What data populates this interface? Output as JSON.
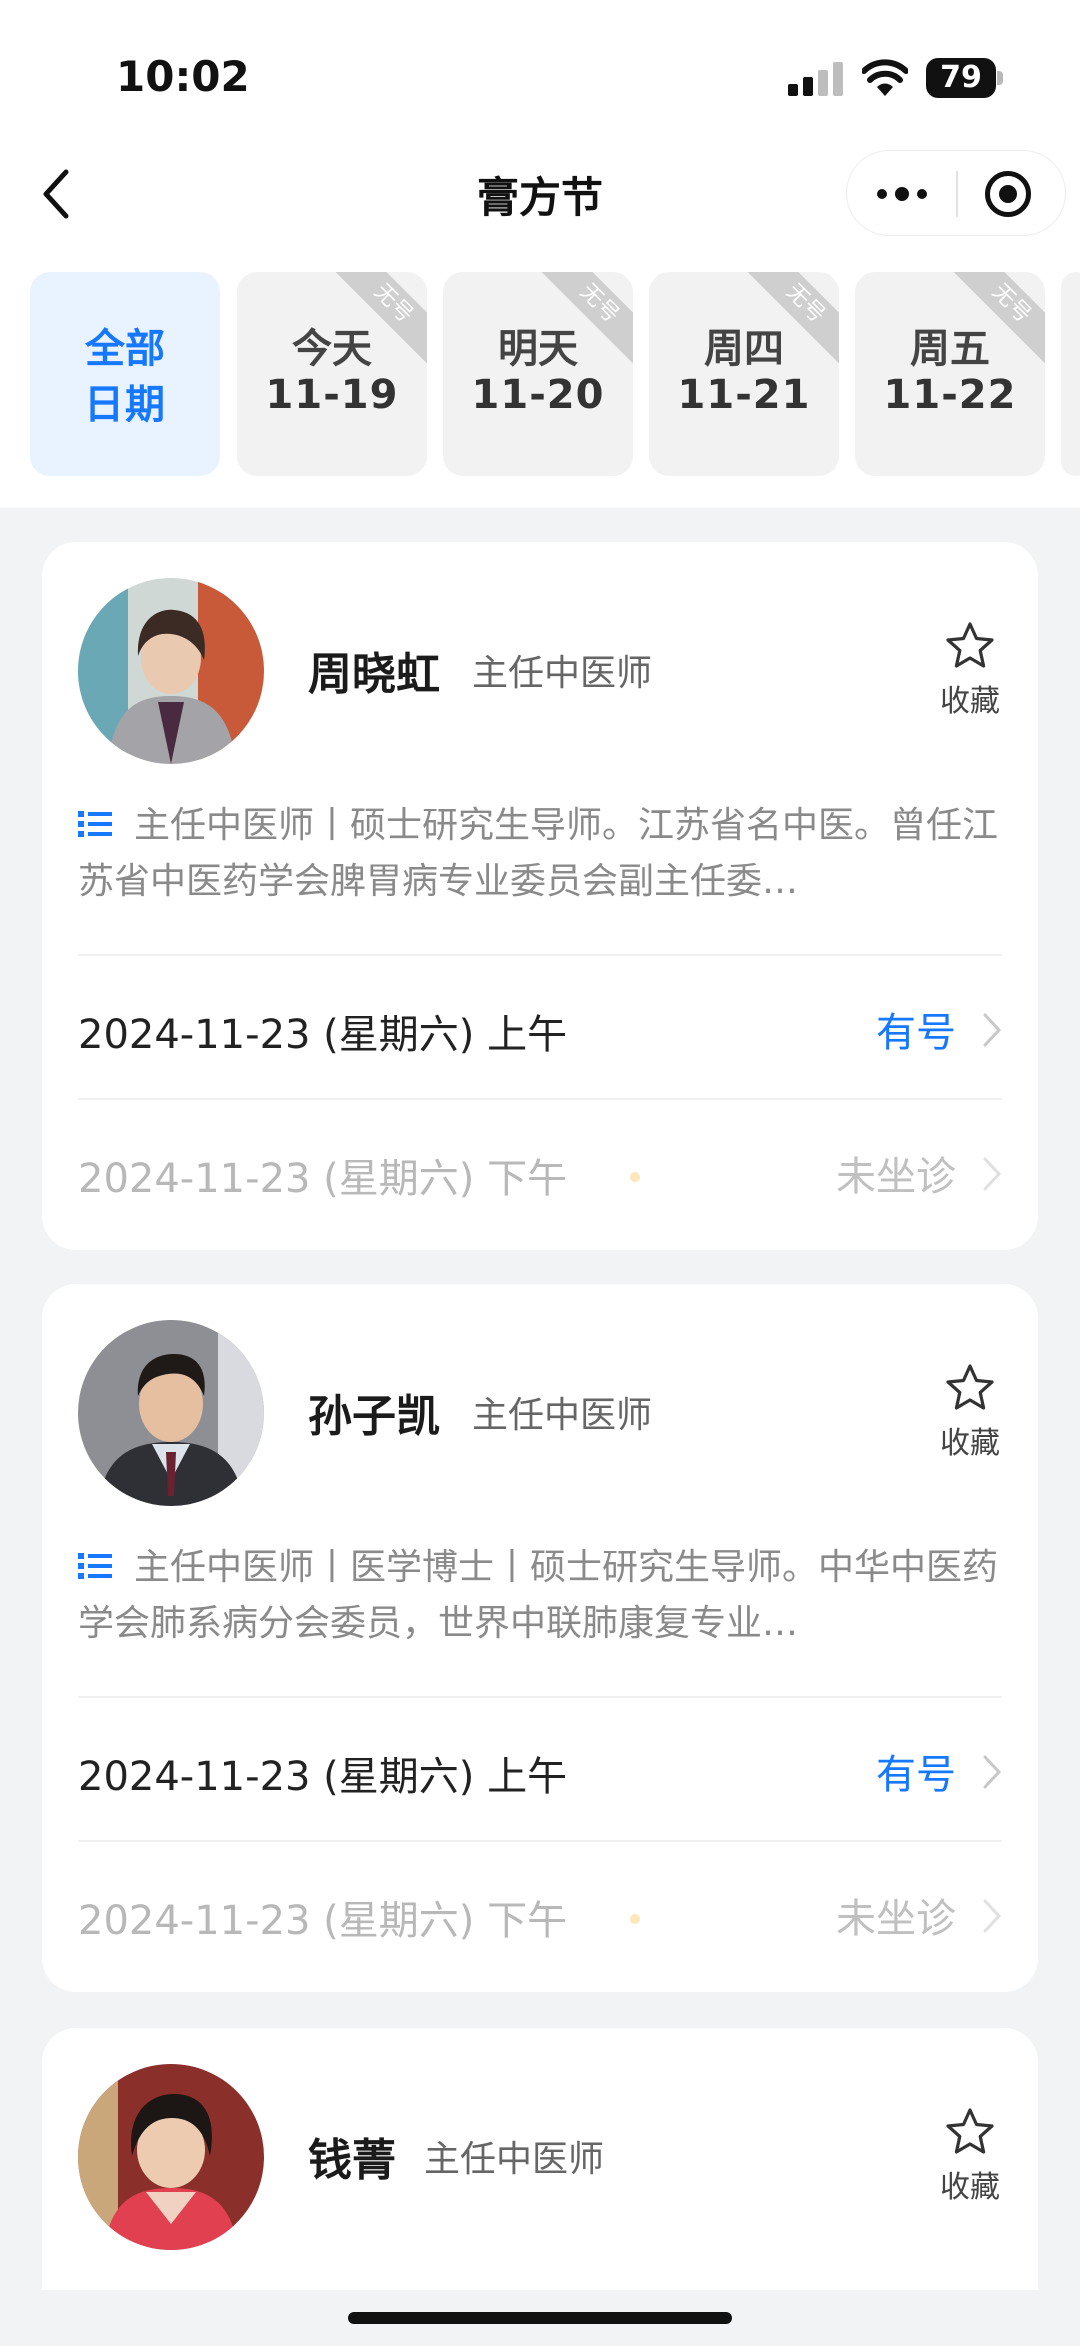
{
  "status_bar": {
    "time": "10:02",
    "battery": "79"
  },
  "nav": {
    "title": "膏方节"
  },
  "date_tabs": [
    {
      "line1": "全部",
      "line2": "日期",
      "active": true,
      "badge": ""
    },
    {
      "line1": "今天",
      "line2": "11-19",
      "active": false,
      "badge": "无号"
    },
    {
      "line1": "明天",
      "line2": "11-20",
      "active": false,
      "badge": "无号"
    },
    {
      "line1": "周四",
      "line2": "11-21",
      "active": false,
      "badge": "无号"
    },
    {
      "line1": "周五",
      "line2": "11-22",
      "active": false,
      "badge": "无号"
    }
  ],
  "favorite_label": "收藏",
  "doctors": [
    {
      "name": "周晓虹",
      "title": "主任中医师",
      "description": "主任中医师丨硕士研究生导师。江苏省名中医。曾任江苏省中医药学会脾胃病专业委员会副主任委…",
      "slots": [
        {
          "date": "2024-11-23 (星期六) 上午",
          "state": "有号",
          "available": true
        },
        {
          "date": "2024-11-23 (星期六) 下午",
          "state": "未坐诊",
          "available": false
        }
      ]
    },
    {
      "name": "孙子凯",
      "title": "主任中医师",
      "description": "主任中医师丨医学博士丨硕士研究生导师。中华中医药学会肺系病分会委员，世界中联肺康复专业…",
      "slots": [
        {
          "date": "2024-11-23 (星期六) 上午",
          "state": "有号",
          "available": true
        },
        {
          "date": "2024-11-23 (星期六) 下午",
          "state": "未坐诊",
          "available": false
        }
      ]
    },
    {
      "name": "钱菁",
      "title": "主任中医师"
    }
  ],
  "colors": {
    "accent": "#1677ff",
    "page_bg": "#f2f3f5",
    "active_tab_bg": "#e9f3ff"
  },
  "icons": [
    "back-arrow-icon",
    "more-dots-icon",
    "target-icon",
    "star-icon",
    "list-icon",
    "chevron-right-icon"
  ]
}
